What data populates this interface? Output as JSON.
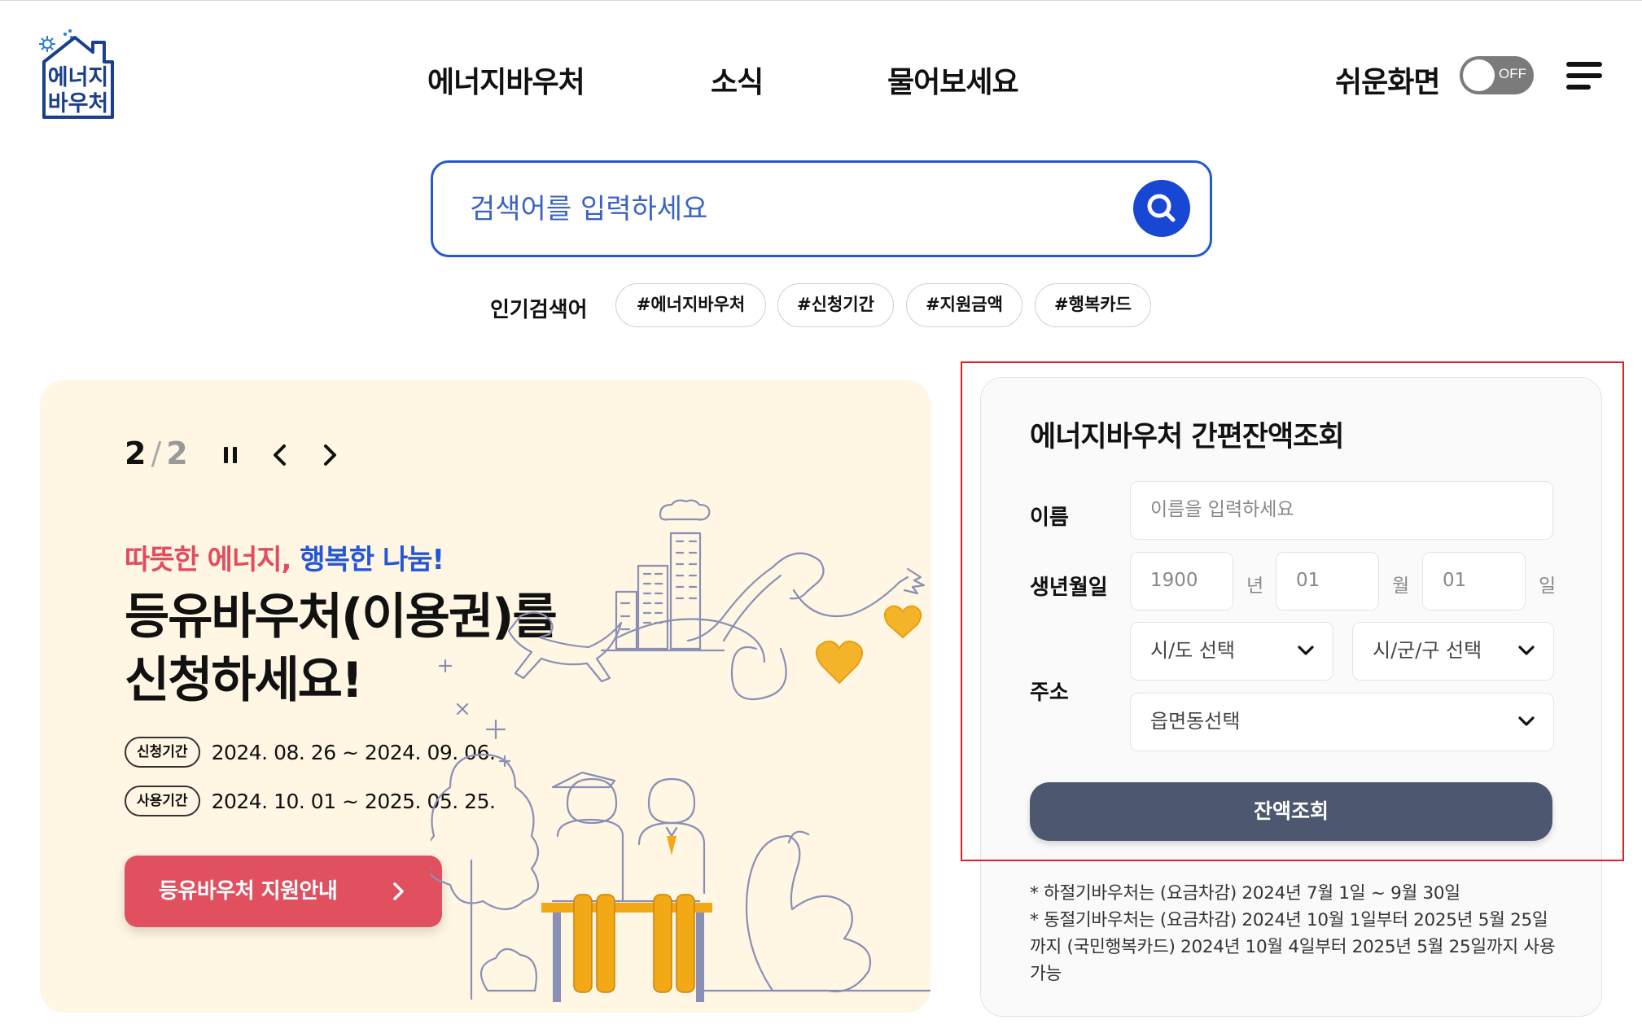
{
  "logo": {
    "line1": "에너지",
    "line2": "바우처"
  },
  "nav": {
    "items": [
      "에너지바우처",
      "소식",
      "물어보세요"
    ]
  },
  "easy_mode": {
    "label": "쉬운화면",
    "toggle_text": "OFF"
  },
  "search": {
    "placeholder": "검색어를 입력하세요"
  },
  "popular": {
    "title": "인기검색어",
    "tags": [
      "#에너지바우처",
      "#신청기간",
      "#지원금액",
      "#행복카드"
    ]
  },
  "banner": {
    "current": "2",
    "total": "2",
    "subtitle_red": "따뜻한 에너지,",
    "subtitle_blue": "행복한 나눔!",
    "title": "등유바우처(이용권)를 신청하세요!",
    "apply_label": "신청기간",
    "apply_value": "2024. 08. 26 ~ 2024. 09. 06.",
    "use_label": "사용기간",
    "use_value": "2024. 10. 01 ~ 2025. 05. 25.",
    "button_label": "등유바우처 지원안내"
  },
  "balance": {
    "title": "에너지바우처 간편잔액조회",
    "name_label": "이름",
    "name_placeholder": "이름을 입력하세요",
    "birth_label": "생년월일",
    "year": "1900",
    "year_unit": "년",
    "month": "01",
    "month_unit": "월",
    "day": "01",
    "day_unit": "일",
    "address_label": "주소",
    "sido": "시/도 선택",
    "sigungu": "시/군/구 선택",
    "eupmyeondong": "읍면동선택",
    "button_label": "잔액조회",
    "notes": [
      "* 하절기바우처는 (요금차감) 2024년 7월 1일 ~ 9월 30일",
      "* 동절기바우처는 (요금차감) 2024년 10월 1일부터 2025년 5월 25일까지 (국민행복카드) 2024년 10월 4일부터 2025년 5월 25일까지 사용 가능"
    ]
  },
  "colors": {
    "primary": "#2457d6",
    "accent_red": "#e0505f",
    "banner_bg": "#fff6e3",
    "button_dark": "#4e5770",
    "highlight": "#e02020"
  }
}
